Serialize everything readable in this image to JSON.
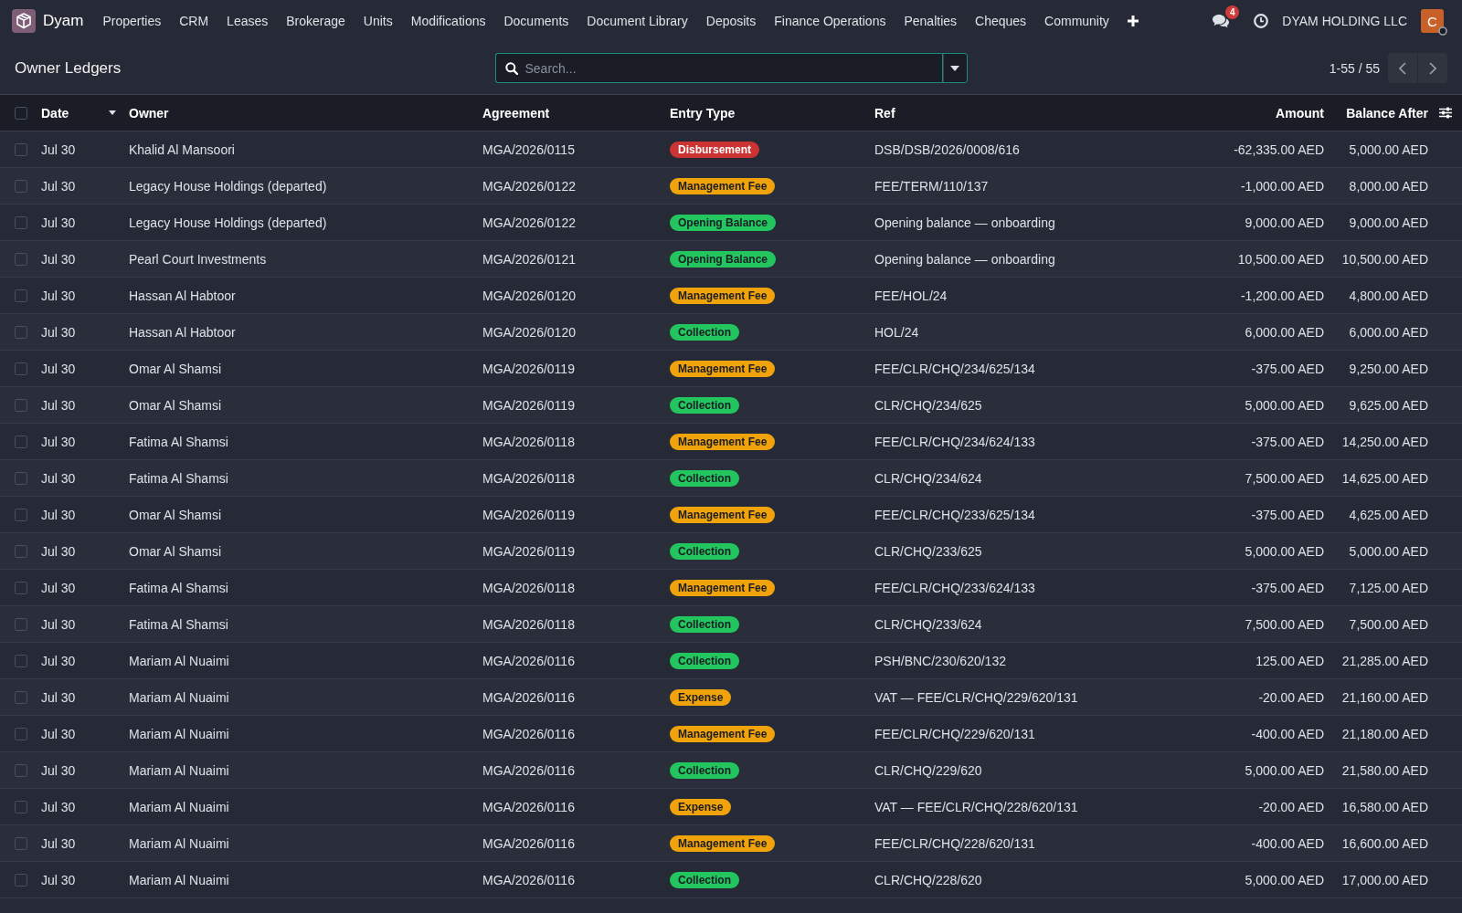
{
  "navbar": {
    "app_name": "Dyam",
    "menu": [
      "Properties",
      "CRM",
      "Leases",
      "Brokerage",
      "Units",
      "Modifications",
      "Documents",
      "Document Library",
      "Deposits",
      "Finance Operations",
      "Penalties",
      "Cheques",
      "Community"
    ],
    "message_count": "4",
    "company": "DYAM HOLDING LLC",
    "user": {
      "initial": "C",
      "online": false
    }
  },
  "control_panel": {
    "title": "Owner Ledgers",
    "search": {
      "placeholder": "Search...",
      "focused": true
    },
    "pager": "1-55 / 55"
  },
  "table": {
    "select_all": {
      "checked": false
    },
    "columns": [
      {
        "label": "Date",
        "kind": "text",
        "sorted": true
      },
      {
        "label": "Owner",
        "kind": "text"
      },
      {
        "label": "Agreement",
        "kind": "text"
      },
      {
        "label": "Entry Type",
        "kind": "badge"
      },
      {
        "label": "Ref",
        "kind": "text"
      },
      {
        "label": "Amount",
        "kind": "money"
      },
      {
        "label": "Balance After",
        "kind": "money"
      }
    ],
    "rows": [
      {
        "selected": false,
        "cells": [
          "Jul 30",
          "Khalid Al Mansoori",
          "MGA/2026/0115",
          {
            "label": "Disbursement",
            "color": "#cc3333"
          },
          "DSB/DSB/2026/0008/616",
          "-62,335.00 AED",
          "5,000.00 AED"
        ]
      },
      {
        "selected": false,
        "cells": [
          "Jul 30",
          "Legacy House Holdings (departed)",
          "MGA/2026/0122",
          {
            "label": "Management Fee",
            "color": "#f0a30a"
          },
          "FEE/TERM/110/137",
          "-1,000.00 AED",
          "8,000.00 AED"
        ]
      },
      {
        "selected": false,
        "cells": [
          "Jul 30",
          "Legacy House Holdings (departed)",
          "MGA/2026/0122",
          {
            "label": "Opening Balance",
            "color": "#22c55e"
          },
          "Opening balance — onboarding",
          "9,000.00 AED",
          "9,000.00 AED"
        ]
      },
      {
        "selected": false,
        "cells": [
          "Jul 30",
          "Pearl Court Investments",
          "MGA/2026/0121",
          {
            "label": "Opening Balance",
            "color": "#22c55e"
          },
          "Opening balance — onboarding",
          "10,500.00 AED",
          "10,500.00 AED"
        ]
      },
      {
        "selected": false,
        "cells": [
          "Jul 30",
          "Hassan Al Habtoor",
          "MGA/2026/0120",
          {
            "label": "Management Fee",
            "color": "#f0a30a"
          },
          "FEE/HOL/24",
          "-1,200.00 AED",
          "4,800.00 AED"
        ]
      },
      {
        "selected": false,
        "cells": [
          "Jul 30",
          "Hassan Al Habtoor",
          "MGA/2026/0120",
          {
            "label": "Collection",
            "color": "#22c55e"
          },
          "HOL/24",
          "6,000.00 AED",
          "6,000.00 AED"
        ]
      },
      {
        "selected": false,
        "cells": [
          "Jul 30",
          "Omar Al Shamsi",
          "MGA/2026/0119",
          {
            "label": "Management Fee",
            "color": "#f0a30a"
          },
          "FEE/CLR/CHQ/234/625/134",
          "-375.00 AED",
          "9,250.00 AED"
        ]
      },
      {
        "selected": false,
        "cells": [
          "Jul 30",
          "Omar Al Shamsi",
          "MGA/2026/0119",
          {
            "label": "Collection",
            "color": "#22c55e"
          },
          "CLR/CHQ/234/625",
          "5,000.00 AED",
          "9,625.00 AED"
        ]
      },
      {
        "selected": false,
        "cells": [
          "Jul 30",
          "Fatima Al Shamsi",
          "MGA/2026/0118",
          {
            "label": "Management Fee",
            "color": "#f0a30a"
          },
          "FEE/CLR/CHQ/234/624/133",
          "-375.00 AED",
          "14,250.00 AED"
        ]
      },
      {
        "selected": false,
        "cells": [
          "Jul 30",
          "Fatima Al Shamsi",
          "MGA/2026/0118",
          {
            "label": "Collection",
            "color": "#22c55e"
          },
          "CLR/CHQ/234/624",
          "7,500.00 AED",
          "14,625.00 AED"
        ]
      },
      {
        "selected": false,
        "cells": [
          "Jul 30",
          "Omar Al Shamsi",
          "MGA/2026/0119",
          {
            "label": "Management Fee",
            "color": "#f0a30a"
          },
          "FEE/CLR/CHQ/233/625/134",
          "-375.00 AED",
          "4,625.00 AED"
        ]
      },
      {
        "selected": false,
        "cells": [
          "Jul 30",
          "Omar Al Shamsi",
          "MGA/2026/0119",
          {
            "label": "Collection",
            "color": "#22c55e"
          },
          "CLR/CHQ/233/625",
          "5,000.00 AED",
          "5,000.00 AED"
        ]
      },
      {
        "selected": false,
        "cells": [
          "Jul 30",
          "Fatima Al Shamsi",
          "MGA/2026/0118",
          {
            "label": "Management Fee",
            "color": "#f0a30a"
          },
          "FEE/CLR/CHQ/233/624/133",
          "-375.00 AED",
          "7,125.00 AED"
        ]
      },
      {
        "selected": false,
        "cells": [
          "Jul 30",
          "Fatima Al Shamsi",
          "MGA/2026/0118",
          {
            "label": "Collection",
            "color": "#22c55e"
          },
          "CLR/CHQ/233/624",
          "7,500.00 AED",
          "7,500.00 AED"
        ]
      },
      {
        "selected": false,
        "cells": [
          "Jul 30",
          "Mariam Al Nuaimi",
          "MGA/2026/0116",
          {
            "label": "Collection",
            "color": "#22c55e"
          },
          "PSH/BNC/230/620/132",
          "125.00 AED",
          "21,285.00 AED"
        ]
      },
      {
        "selected": false,
        "cells": [
          "Jul 30",
          "Mariam Al Nuaimi",
          "MGA/2026/0116",
          {
            "label": "Expense",
            "color": "#f0a30a"
          },
          "VAT — FEE/CLR/CHQ/229/620/131",
          "-20.00 AED",
          "21,160.00 AED"
        ]
      },
      {
        "selected": false,
        "cells": [
          "Jul 30",
          "Mariam Al Nuaimi",
          "MGA/2026/0116",
          {
            "label": "Management Fee",
            "color": "#f0a30a"
          },
          "FEE/CLR/CHQ/229/620/131",
          "-400.00 AED",
          "21,180.00 AED"
        ]
      },
      {
        "selected": false,
        "cells": [
          "Jul 30",
          "Mariam Al Nuaimi",
          "MGA/2026/0116",
          {
            "label": "Collection",
            "color": "#22c55e"
          },
          "CLR/CHQ/229/620",
          "5,000.00 AED",
          "21,580.00 AED"
        ]
      },
      {
        "selected": false,
        "cells": [
          "Jul 30",
          "Mariam Al Nuaimi",
          "MGA/2026/0116",
          {
            "label": "Expense",
            "color": "#f0a30a"
          },
          "VAT — FEE/CLR/CHQ/228/620/131",
          "-20.00 AED",
          "16,580.00 AED"
        ]
      },
      {
        "selected": false,
        "cells": [
          "Jul 30",
          "Mariam Al Nuaimi",
          "MGA/2026/0116",
          {
            "label": "Management Fee",
            "color": "#f0a30a"
          },
          "FEE/CLR/CHQ/228/620/131",
          "-400.00 AED",
          "16,600.00 AED"
        ]
      },
      {
        "selected": false,
        "cells": [
          "Jul 30",
          "Mariam Al Nuaimi",
          "MGA/2026/0116",
          {
            "label": "Collection",
            "color": "#22c55e"
          },
          "CLR/CHQ/228/620",
          "5,000.00 AED",
          "17,000.00 AED"
        ]
      }
    ]
  }
}
